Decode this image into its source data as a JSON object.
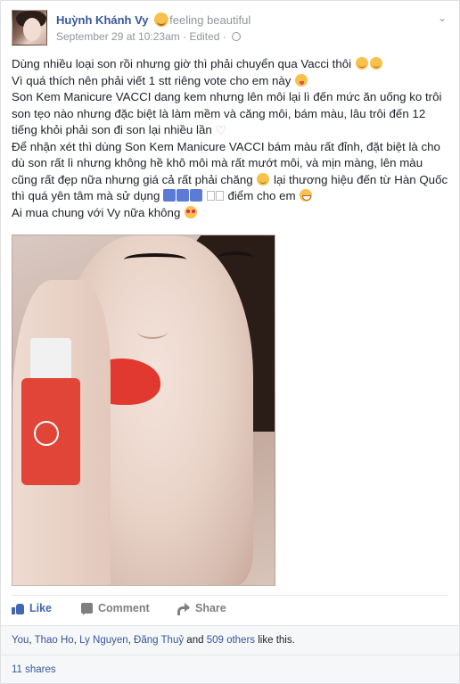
{
  "post": {
    "author": "Huỳnh Khánh Vy",
    "feeling": "feeling beautiful",
    "timestamp": "September 29 at 10:23am",
    "edited": "Edited",
    "separator": "·",
    "paragraphs": [
      "Dùng nhiều loại son rồi nhưng giờ thì phải chuyển qua Vacci thôi",
      "Vì quá thích nên phải viết 1 stt riêng vote cho em này",
      "Son Kem Manicure VACCI dang kem nhưng lên môi lại lì đến mức ăn uống ko trôi son tẹo nào nhưng đặc biệt là làm mềm và căng môi, bám màu, lâu trôi đến 12 tiếng khỏi phải son đi son lại nhiều lần",
      "Để nhận xét thì dùng Son Kem Manicure VACCI bám màu rất đỉnh, đặt biệt là cho dù son rất lì nhưng không hề khô môi mà rất mướt môi, và mịn màng, lên màu cũng rất đẹp nữa nhưng giá cả rất phải chăng",
      "lại thương hiệu đến từ Hàn Quốc thì quá yên tâm mà sử dụng",
      "điểm cho em",
      "Ai mua chung với Vy nữa không"
    ]
  },
  "actions": {
    "like": "Like",
    "comment": "Comment",
    "share": "Share"
  },
  "footer": {
    "likers": [
      "You",
      "Thao Ho",
      "Ly Nguyen",
      "Đăng Thuỷ"
    ],
    "and_word": "and",
    "others": "509 others",
    "like_suffix": "like this.",
    "shares": "11 shares"
  },
  "colors": {
    "link": "#365899",
    "like_active": "#4267b2",
    "muted": "#90949c"
  }
}
